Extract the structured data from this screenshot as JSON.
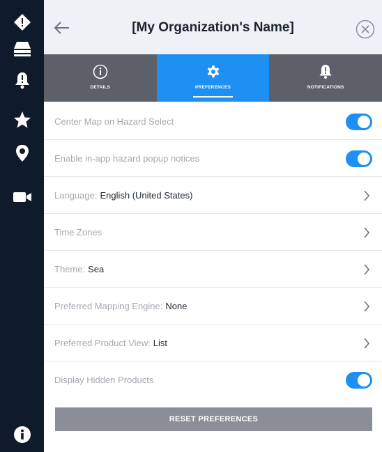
{
  "header": {
    "title": "[My Organization's Name]",
    "back_icon": "arrow-left-icon",
    "close_icon": "close-circle-icon"
  },
  "rail": {
    "items": [
      {
        "icon": "directions-diamond-icon"
      },
      {
        "icon": "layers-drawer-icon"
      },
      {
        "icon": "alert-bell-icon"
      },
      {
        "icon": "star-icon"
      },
      {
        "icon": "location-pin-icon"
      },
      {
        "icon": "video-camera-icon"
      },
      {
        "icon": "info-icon"
      }
    ]
  },
  "tabs": [
    {
      "label": "DETAILS",
      "icon": "info-circle-icon",
      "active": false
    },
    {
      "label": "PREFERENCES",
      "icon": "gear-icon",
      "active": true
    },
    {
      "label": "NOTIFICATIONS",
      "icon": "bell-icon",
      "active": false
    }
  ],
  "preferences": {
    "center_map": {
      "label": "Center Map on Hazard Select",
      "enabled": true
    },
    "popup_notices": {
      "label": "Enable in-app hazard popup notices",
      "enabled": true
    },
    "language": {
      "label": "Language:",
      "value": "English (United States)"
    },
    "time_zones": {
      "label": "Time Zones"
    },
    "theme": {
      "label": "Theme:",
      "value": "Sea"
    },
    "mapping_engine": {
      "label": "Preferred Mapping Engine:",
      "value": "None"
    },
    "product_view": {
      "label": "Preferred Product View:",
      "value": "List"
    },
    "hidden_products": {
      "label": "Display Hidden Products",
      "enabled": true
    }
  },
  "reset_button": {
    "label": "RESET PREFERENCES"
  },
  "colors": {
    "accent": "#1e90f3",
    "rail": "#0f1a2b",
    "tabs": "#5b6069",
    "button": "#8a8f97"
  }
}
